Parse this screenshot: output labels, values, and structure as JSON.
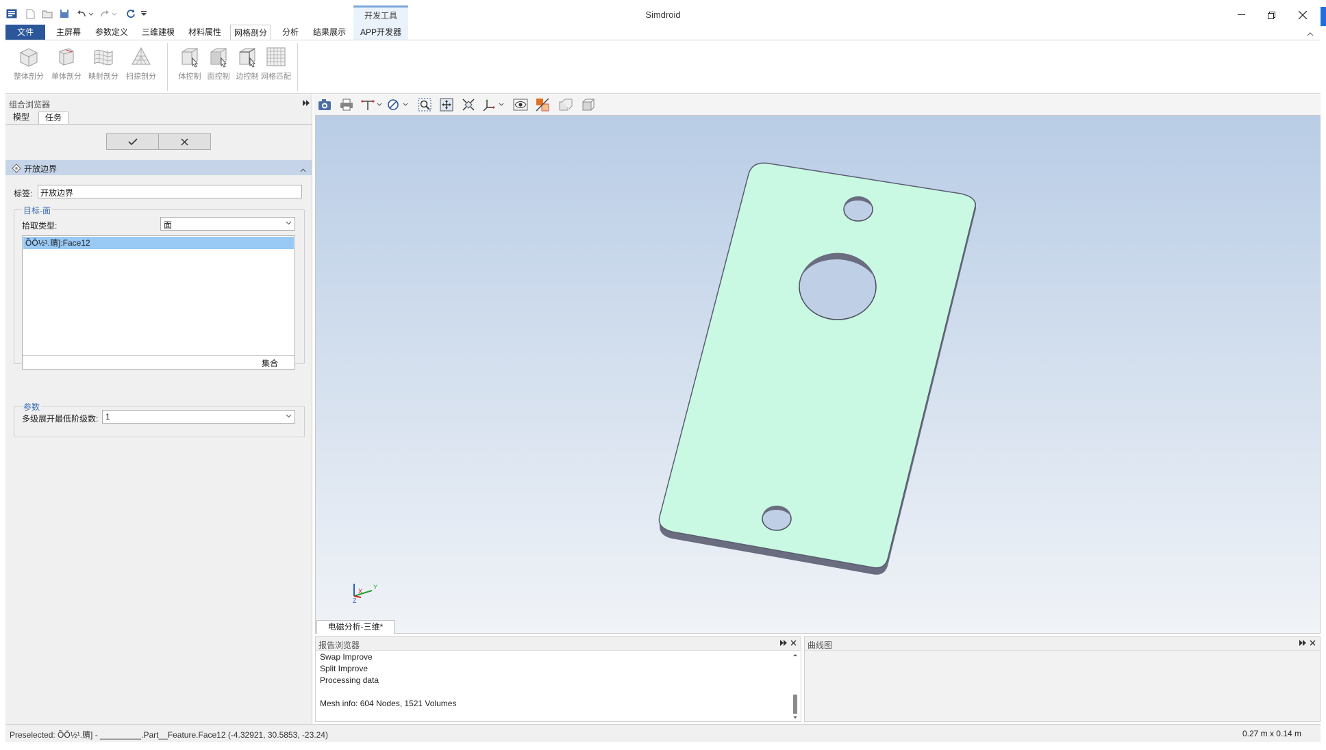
{
  "app": {
    "title": "Simdroid"
  },
  "ribbon": {
    "context_group": "开发工具",
    "tabs": [
      {
        "label": "文件"
      },
      {
        "label": "主屏幕"
      },
      {
        "label": "参数定义"
      },
      {
        "label": "三维建模"
      },
      {
        "label": "材料属性"
      },
      {
        "label": "网格剖分"
      },
      {
        "label": "分析"
      },
      {
        "label": "结果展示"
      },
      {
        "label": "APP开发器"
      }
    ],
    "active_tab": "网格剖分",
    "buttons": [
      {
        "label": "整体剖分",
        "icon": "cube-mesh-icon"
      },
      {
        "label": "单体剖分",
        "icon": "single-body-mesh-icon"
      },
      {
        "label": "映射剖分",
        "icon": "mapped-mesh-icon"
      },
      {
        "label": "扫掠剖分",
        "icon": "sweep-mesh-icon"
      },
      {
        "label": "体控制",
        "icon": "body-control-icon"
      },
      {
        "label": "面控制",
        "icon": "face-control-icon"
      },
      {
        "label": "边控制",
        "icon": "edge-control-icon"
      },
      {
        "label": "网格匹配",
        "icon": "mesh-match-icon"
      }
    ]
  },
  "left_panel": {
    "title": "组合浏览器",
    "tabs": [
      {
        "label": "模型"
      },
      {
        "label": "任务"
      }
    ],
    "section_title": "开放边界",
    "label_field": {
      "label": "标签:",
      "value": "开放边界"
    },
    "target_group": {
      "title": "目标-面",
      "pick_type_label": "拾取类型:",
      "pick_type_value": "面",
      "selected_item": "ȌǑ½¹.䞍]:Face12",
      "set_button": "集合"
    },
    "params_group": {
      "title": "参数",
      "level_label": "多级展开最低阶级数:",
      "level_value": "1"
    }
  },
  "viewport": {
    "doc_tab": "电磁分析-三维*",
    "triad": {
      "x": "X",
      "y": "Y",
      "z": "Z"
    }
  },
  "report": {
    "title": "报告浏览器",
    "lines": [
      "Swap Improve",
      "Split Improve",
      "Processing data",
      "",
      "Mesh info: 604 Nodes, 1521 Volumes"
    ]
  },
  "curve": {
    "title": "曲线图"
  },
  "status": {
    "left": "Preselected: ȌǑ½¹.䞍] - _________.Part__Feature.Face12 (-4.32921, 30.5853, -23.24)",
    "right": "0.27 m x 0.14 m"
  },
  "colors": {
    "accent": "#2b579a",
    "part_face": "#c9f8e3",
    "part_side": "#6a6c80",
    "view_top": "#b9cde6",
    "view_bottom": "#f0f3f7"
  }
}
